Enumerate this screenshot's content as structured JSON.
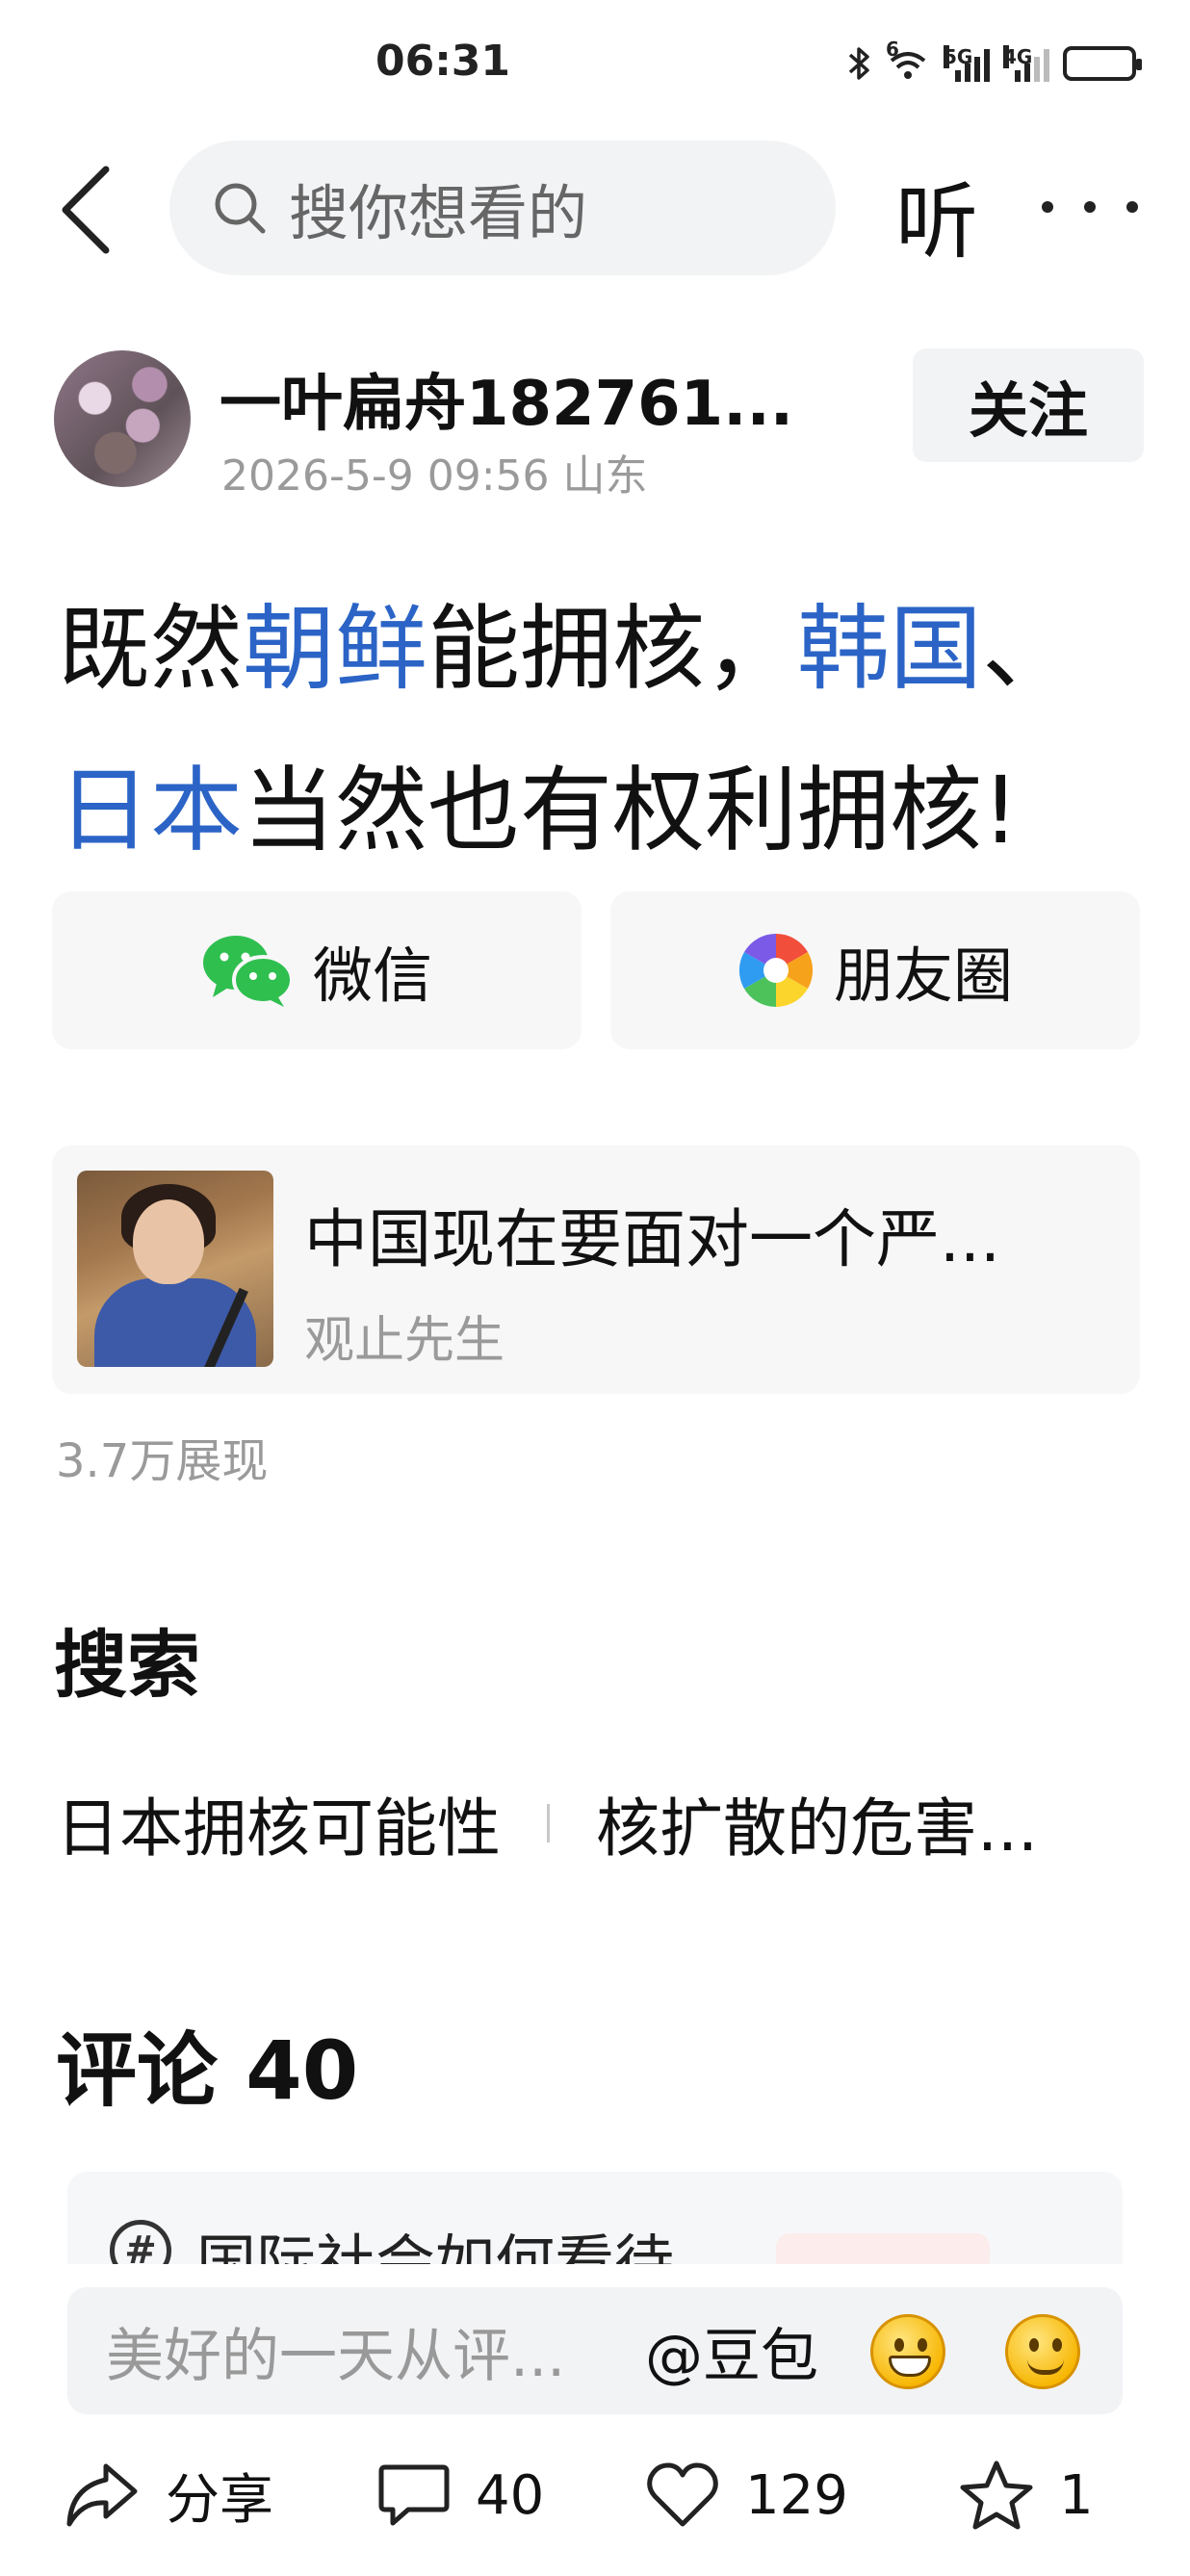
{
  "status_bar": {
    "time": "06:31",
    "network_1": "5G",
    "network_2": "4G",
    "wifi_badge": "6",
    "icons": [
      "bluetooth-icon",
      "wifi-icon",
      "signal-5g-icon",
      "signal-4g-icon",
      "battery-icon"
    ]
  },
  "nav": {
    "search_placeholder": "搜你想看的",
    "listen_label": "听",
    "icons": [
      "back-arrow-icon",
      "search-icon",
      "more-dots-icon"
    ]
  },
  "author": {
    "name": "一叶扁舟182761...",
    "meta": "2026-5-9 09:56 山东",
    "follow_label": "关注"
  },
  "post": {
    "title_segments": {
      "s1": "既然",
      "s2": "朝鲜",
      "s3": "能拥核，",
      "s4": "韩国",
      "s5": "、",
      "s6": "日本",
      "s7": "当然也有权利拥核!"
    },
    "keyword_color": "#2b64c6"
  },
  "share": {
    "wechat_label": "微信",
    "moments_label": "朋友圈"
  },
  "related_article": {
    "title": "中国现在要面对一个严...",
    "source": "观止先生"
  },
  "views": "3.7万展现",
  "search_section": {
    "heading": "搜索",
    "tags": [
      "日本拥核可能性",
      "核扩散的危害..."
    ]
  },
  "comments": {
    "heading": "评论 40",
    "topic_text": "国际社会如何看待",
    "topic_icon": "hashtag-icon"
  },
  "composer": {
    "placeholder": "美好的一天从评...",
    "mention": "@豆包"
  },
  "actions": {
    "share_label": "分享",
    "comment_count": "40",
    "like_count": "129",
    "favorite_count": "1"
  }
}
